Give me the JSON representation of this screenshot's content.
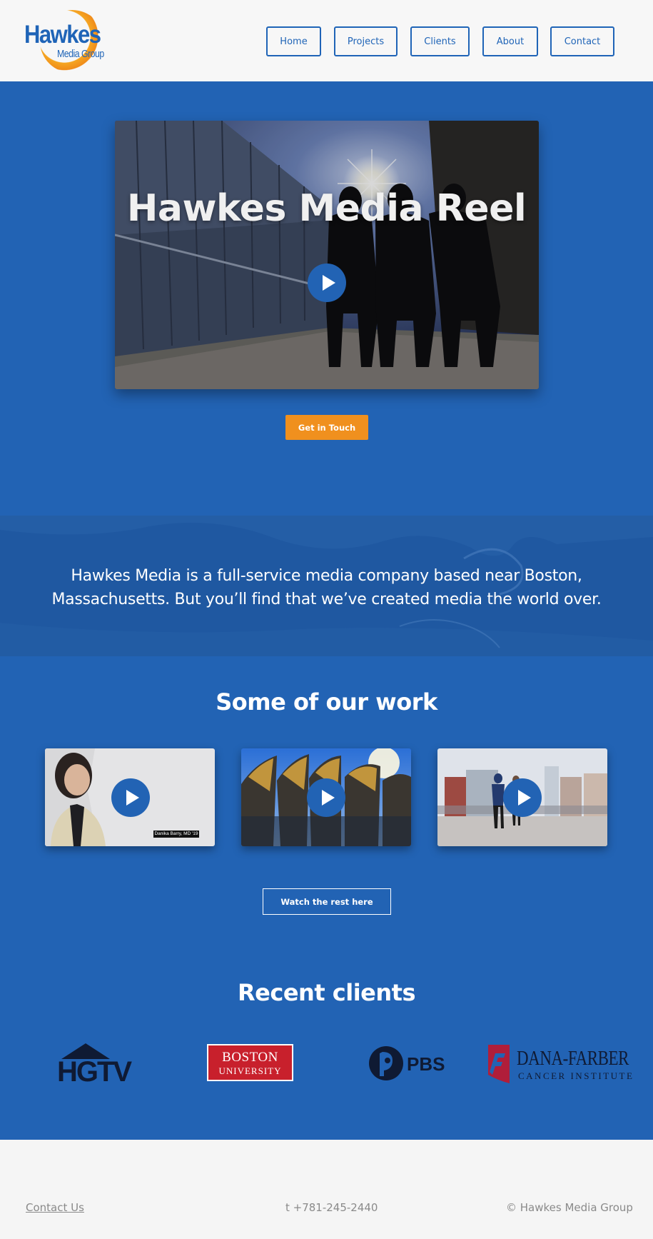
{
  "header": {
    "logo_text": "Hawkes",
    "logo_subtext": "Media Group",
    "nav": [
      {
        "label": "Home"
      },
      {
        "label": "Projects"
      },
      {
        "label": "Clients"
      },
      {
        "label": "About"
      },
      {
        "label": "Contact"
      }
    ]
  },
  "hero": {
    "reel_title": "Hawkes Media Reel",
    "cta_label": "Get in Touch"
  },
  "intro": {
    "line1": "Hawkes Media is a full-service media company based near Boston,",
    "line2": "Massachusetts. But you’ll find that we’ve created media the world over."
  },
  "work": {
    "heading": "Some of our work",
    "thumb1_caption": "Danika Barry, MD '19",
    "watch_more_label": "Watch the rest here"
  },
  "clients": {
    "heading": "Recent clients",
    "logos": [
      {
        "text": "HGTV"
      },
      {
        "line1": "BOSTON",
        "line2": "UNIVERSITY"
      },
      {
        "text": "PBS"
      },
      {
        "line1": "DANA-FARBER",
        "line2": "CANCER INSTITUTE"
      }
    ]
  },
  "footer": {
    "contact_link": "Contact Us",
    "phone": "t +781-245-2440",
    "copyright": "© Hawkes Media Group"
  },
  "colors": {
    "brand_blue": "#2263b4",
    "accent_orange": "#f0901e",
    "footer_bg": "#f5f5f5"
  },
  "icons": [
    "play-icon"
  ]
}
